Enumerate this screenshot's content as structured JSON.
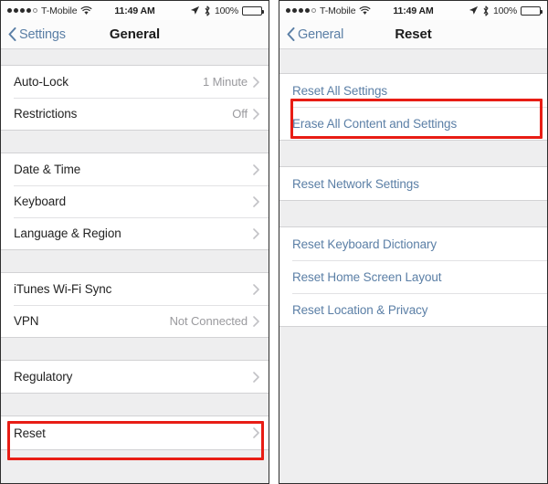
{
  "left_screen": {
    "status_bar": {
      "signal_dots_filled": 4,
      "signal_dots_total": 5,
      "carrier": "T-Mobile",
      "wifi_icon": "wifi-icon",
      "time": "11:49 AM",
      "location_icon": "location-arrow-icon",
      "bluetooth_icon": "bluetooth-icon",
      "battery_percent": "100%",
      "battery_icon": "battery-full-icon"
    },
    "nav": {
      "back_label": "Settings",
      "back_icon": "chevron-left-icon",
      "title": "General"
    },
    "sections": [
      {
        "rows": [
          {
            "label": "Auto-Lock",
            "value": "1 Minute",
            "chevron": true
          },
          {
            "label": "Restrictions",
            "value": "Off",
            "chevron": true
          }
        ]
      },
      {
        "rows": [
          {
            "label": "Date & Time",
            "value": "",
            "chevron": true
          },
          {
            "label": "Keyboard",
            "value": "",
            "chevron": true
          },
          {
            "label": "Language & Region",
            "value": "",
            "chevron": true
          }
        ]
      },
      {
        "rows": [
          {
            "label": "iTunes Wi-Fi Sync",
            "value": "",
            "chevron": true
          },
          {
            "label": "VPN",
            "value": "Not Connected",
            "chevron": true
          }
        ]
      },
      {
        "rows": [
          {
            "label": "Regulatory",
            "value": "",
            "chevron": true
          }
        ]
      },
      {
        "rows": [
          {
            "label": "Reset",
            "value": "",
            "chevron": true
          }
        ]
      }
    ],
    "highlight": {
      "target_label": "Reset",
      "color": "#e81d15"
    }
  },
  "right_screen": {
    "status_bar": {
      "signal_dots_filled": 4,
      "signal_dots_total": 5,
      "carrier": "T-Mobile",
      "wifi_icon": "wifi-icon",
      "time": "11:49 AM",
      "location_icon": "location-arrow-icon",
      "bluetooth_icon": "bluetooth-icon",
      "battery_percent": "100%",
      "battery_icon": "battery-full-icon"
    },
    "nav": {
      "back_label": "General",
      "back_icon": "chevron-left-icon",
      "title": "Reset"
    },
    "sections": [
      {
        "rows": [
          {
            "label": "Reset All Settings",
            "value": "",
            "chevron": false
          },
          {
            "label": "Erase All Content and Settings",
            "value": "",
            "chevron": false
          }
        ]
      },
      {
        "rows": [
          {
            "label": "Reset Network Settings",
            "value": "",
            "chevron": false
          }
        ]
      },
      {
        "rows": [
          {
            "label": "Reset Keyboard Dictionary",
            "value": "",
            "chevron": false
          },
          {
            "label": "Reset Home Screen Layout",
            "value": "",
            "chevron": false
          },
          {
            "label": "Reset Location & Privacy",
            "value": "",
            "chevron": false
          }
        ]
      }
    ],
    "highlight": {
      "target_label": "Erase All Content and Settings",
      "color": "#e81d15"
    }
  }
}
